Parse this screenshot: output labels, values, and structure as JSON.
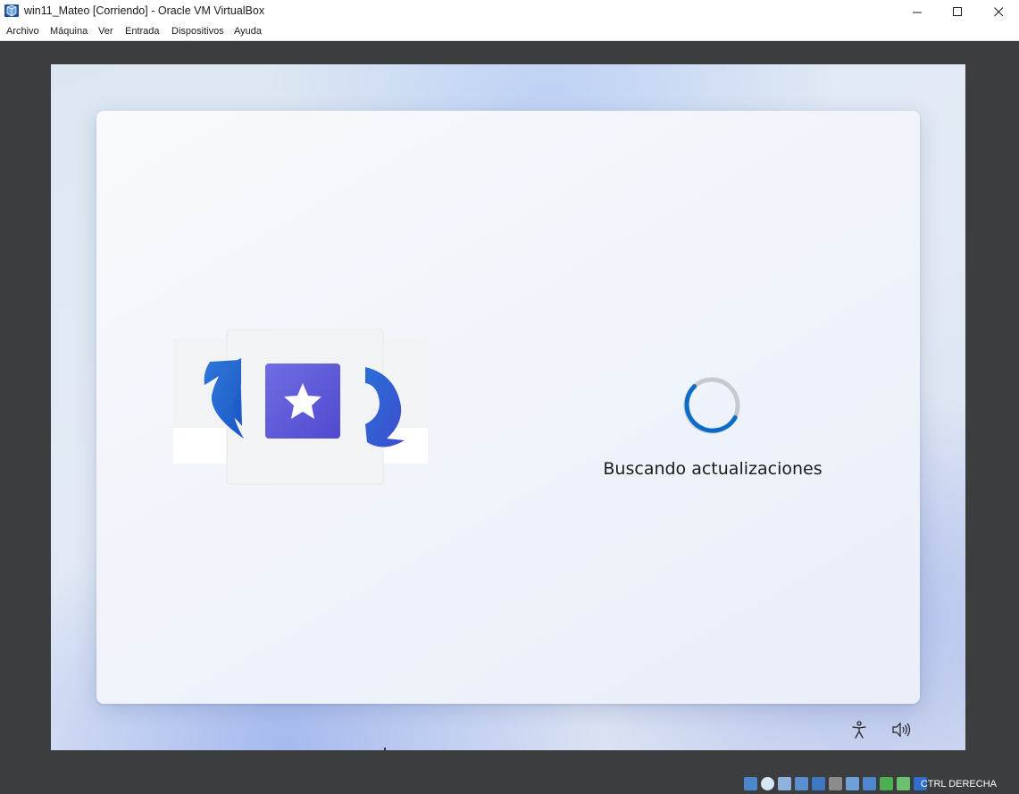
{
  "window": {
    "title": "win11_Mateo [Corriendo] - Oracle VM VirtualBox",
    "app_icon": "virtualbox-icon",
    "controls": [
      "minimize-icon",
      "maximize-icon",
      "close-icon"
    ]
  },
  "menu": {
    "items": [
      "Archivo",
      "Máquina",
      "Ver",
      "Entrada",
      "Dispositivos",
      "Ayuda"
    ]
  },
  "guest": {
    "status_text": "Buscando actualizaciones",
    "illustration": "windows-update-icon",
    "spinner": "loading-spinner",
    "accent_color": "#0a6cc9",
    "icons": [
      "accessibility-icon",
      "speaker-icon"
    ]
  },
  "statusbar": {
    "icons": [
      "hard-disk-icon",
      "optical-drive-icon",
      "audio-icon",
      "network-icon",
      "usb-icon",
      "shared-folders-icon",
      "display-icon",
      "video-capture-icon",
      "recording-icon",
      "cpu-icon",
      "mouse-integration-icon",
      "keyboard-capture-icon"
    ],
    "host_key": "CTRL DERECHA"
  }
}
